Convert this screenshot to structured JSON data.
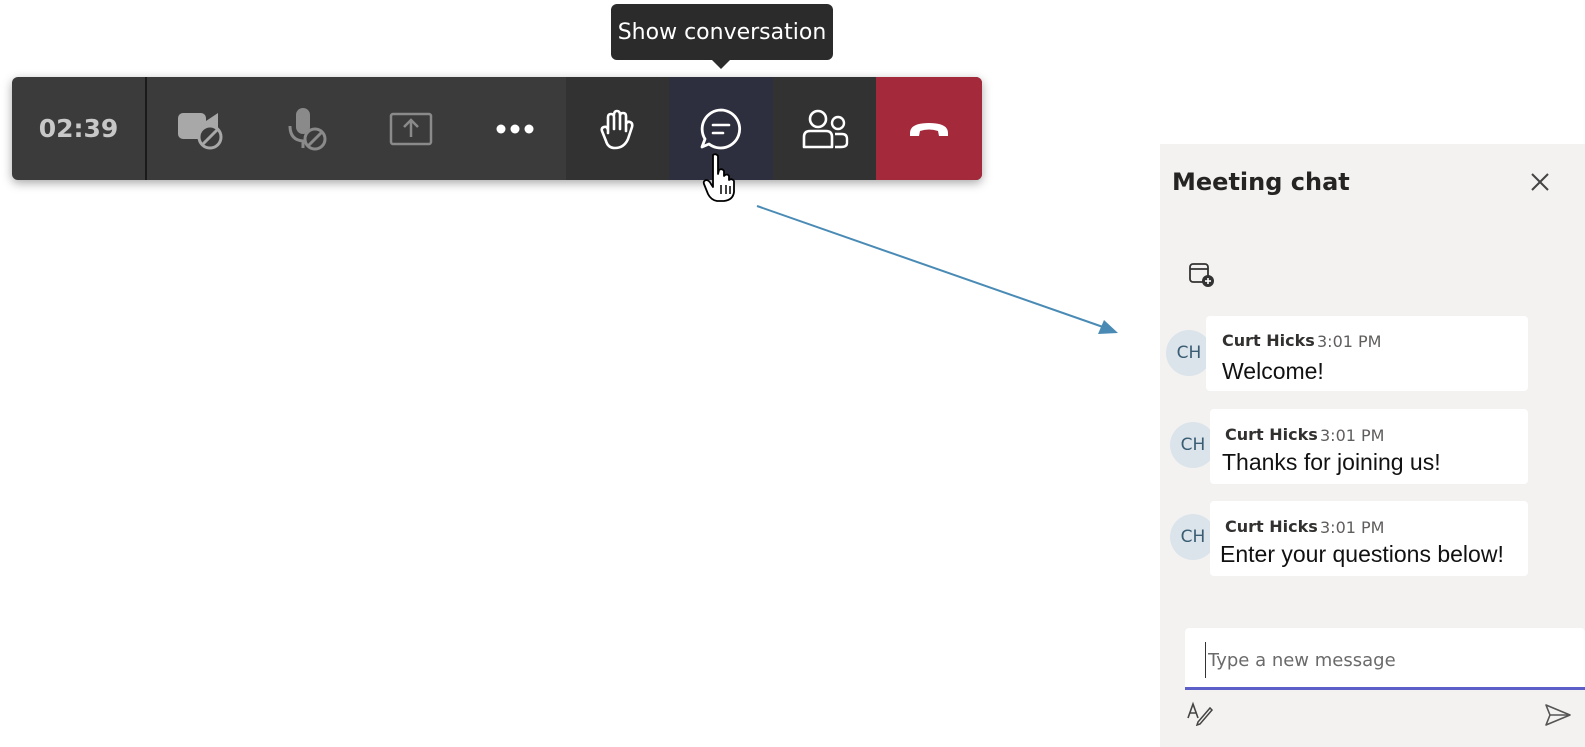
{
  "tooltip": {
    "text": "Show conversation"
  },
  "toolbar": {
    "timer": "02:39",
    "buttons": [
      "camera-off-icon",
      "mic-off-icon",
      "share-screen-icon",
      "more-icon",
      "raise-hand-icon",
      "chat-icon",
      "participants-icon",
      "hang-up-icon"
    ]
  },
  "chat": {
    "title": "Meeting chat",
    "messages": [
      {
        "initials": "CH",
        "sender": "Curt Hicks",
        "time": "3:01 PM",
        "text": "Welcome!"
      },
      {
        "initials": "CH",
        "sender": "Curt Hicks",
        "time": "3:01 PM",
        "text": "Thanks for joining us!"
      },
      {
        "initials": "CH",
        "sender": "Curt Hicks",
        "time": "3:01 PM",
        "text": "Enter your questions below!"
      }
    ],
    "compose_placeholder": "Type a new message"
  },
  "colors": {
    "toolbar_bg": "#3b3b3b",
    "hangup": "#a4293b",
    "accent": "#5b5fc7",
    "annotation_arrow": "#4a8bb5"
  }
}
